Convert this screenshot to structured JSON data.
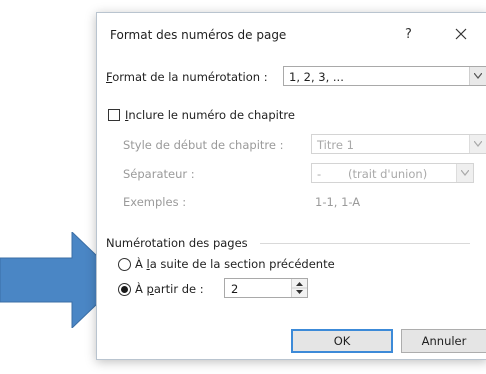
{
  "dialog": {
    "title": "Format des numéros de page",
    "help": "?",
    "number_format": {
      "label_key": "F",
      "label_rest": "ormat de la numérotation :",
      "value": "1, 2, 3, ..."
    },
    "include_chapter": {
      "label_key": "I",
      "label_rest": "nclure le numéro de chapitre",
      "checked": false
    },
    "chapter_style": {
      "label": "Style de début de chapitre :",
      "value": "Titre 1"
    },
    "separator": {
      "label": "Séparateur :",
      "value": "-",
      "value_note": "(trait d'union)"
    },
    "examples": {
      "label": "Exemples :",
      "value": "1-1, 1-A"
    },
    "page_numbering": {
      "heading": "Numérotation des pages",
      "continue_option": {
        "pre": "À ",
        "key": "l",
        "rest": "a suite de la section précédente",
        "selected": false
      },
      "start_at_option": {
        "pre": "À ",
        "key": "p",
        "rest": "artir de :",
        "selected": true
      },
      "start_at_value": "2"
    },
    "ok_label": "OK",
    "cancel_label": "Annuler"
  },
  "colors": {
    "pointer_arrow": "#4a86c5",
    "ok_border": "#3c8ad8"
  },
  "icons": [
    "close-icon",
    "dropdown-arrow-icon",
    "spin-up-icon",
    "spin-down-icon",
    "pointer-arrow"
  ]
}
